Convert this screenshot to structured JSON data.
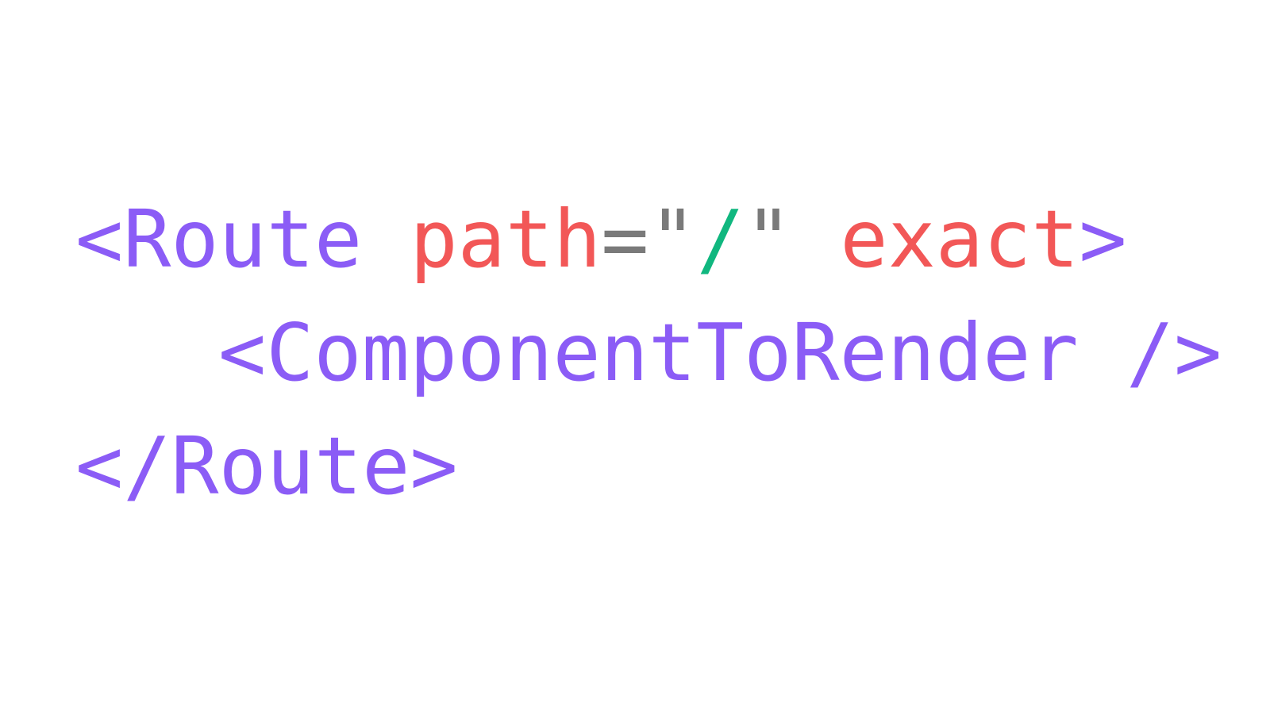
{
  "colors": {
    "tag": "#8b5cf6",
    "attribute": "#f25757",
    "punctuation": "#7a7a7a",
    "string": "#10b77f",
    "background": "#ffffff"
  },
  "code": {
    "line1": {
      "open_bracket": "<",
      "tag_name": "Route",
      "space1": " ",
      "attr_path": "path",
      "equals": "=",
      "quote_open": "\"",
      "path_value": "/",
      "quote_close": "\"",
      "space2": " ",
      "attr_exact": "exact",
      "close_bracket": ">"
    },
    "line2": {
      "open_bracket": "<",
      "tag_name": "ComponentToRender",
      "space": " ",
      "self_close": "/>"
    },
    "line3": {
      "open_bracket": "</",
      "tag_name": "Route",
      "close_bracket": ">"
    }
  }
}
